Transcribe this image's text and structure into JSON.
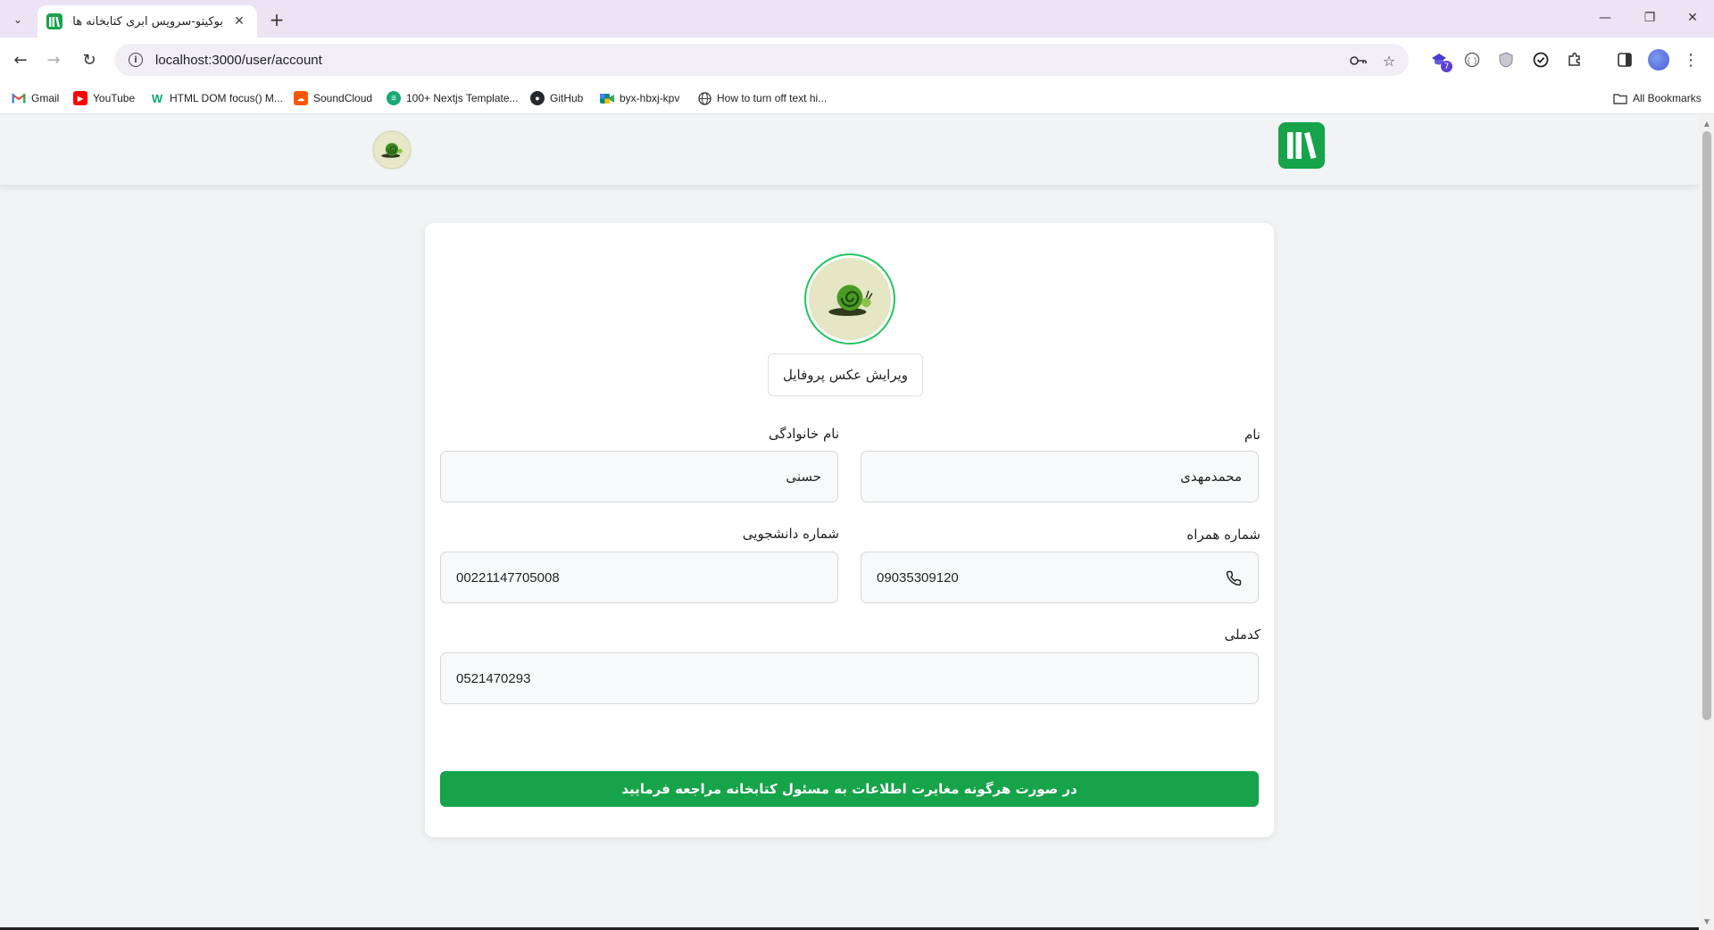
{
  "browser": {
    "tab_title": "بوکیتو-سرویس ابری کتابخانه های دانشگاه",
    "url": "localhost:3000/user/account",
    "extension_badge": "7",
    "bookmarks": [
      {
        "label": "Gmail",
        "icon": "gmail-icon",
        "color": "#ea4335"
      },
      {
        "label": "YouTube",
        "icon": "youtube-icon",
        "color": "#ff0000"
      },
      {
        "label": "HTML DOM focus() M...",
        "icon": "w3schools-icon",
        "color": "#04aa6d"
      },
      {
        "label": "SoundCloud",
        "icon": "soundcloud-icon",
        "color": "#ff5500"
      },
      {
        "label": "100+ Nextjs Template...",
        "icon": "template-icon",
        "color": "#19a974"
      },
      {
        "label": "GitHub",
        "icon": "github-icon",
        "color": "#24292f"
      },
      {
        "label": "byx-hbxj-kpv",
        "icon": "meet-icon",
        "color": "#00897b"
      },
      {
        "label": "How to turn off text hi...",
        "icon": "globe-icon",
        "color": "#444444"
      }
    ],
    "all_bookmarks": "All Bookmarks"
  },
  "profile": {
    "edit_photo_label": "ویرایش عکس پروفایل",
    "first_name_label": "نام",
    "first_name_value": "محمدمهدی",
    "last_name_label": "نام خانوادگی",
    "last_name_value": "حسنی",
    "phone_label": "شماره همراه",
    "phone_value": "09035309120",
    "student_id_label": "شماره دانشجویی",
    "student_id_value": "00221147705008",
    "national_id_label": "کدملی",
    "national_id_value": "0521470293",
    "notice": "در صورت هرگونه مغایرت اطلاعات به مسئول کتابخانه مراجعه فرمایید"
  },
  "colors": {
    "brand_green": "#16a34a",
    "avatar_ring": "#22c55e"
  }
}
